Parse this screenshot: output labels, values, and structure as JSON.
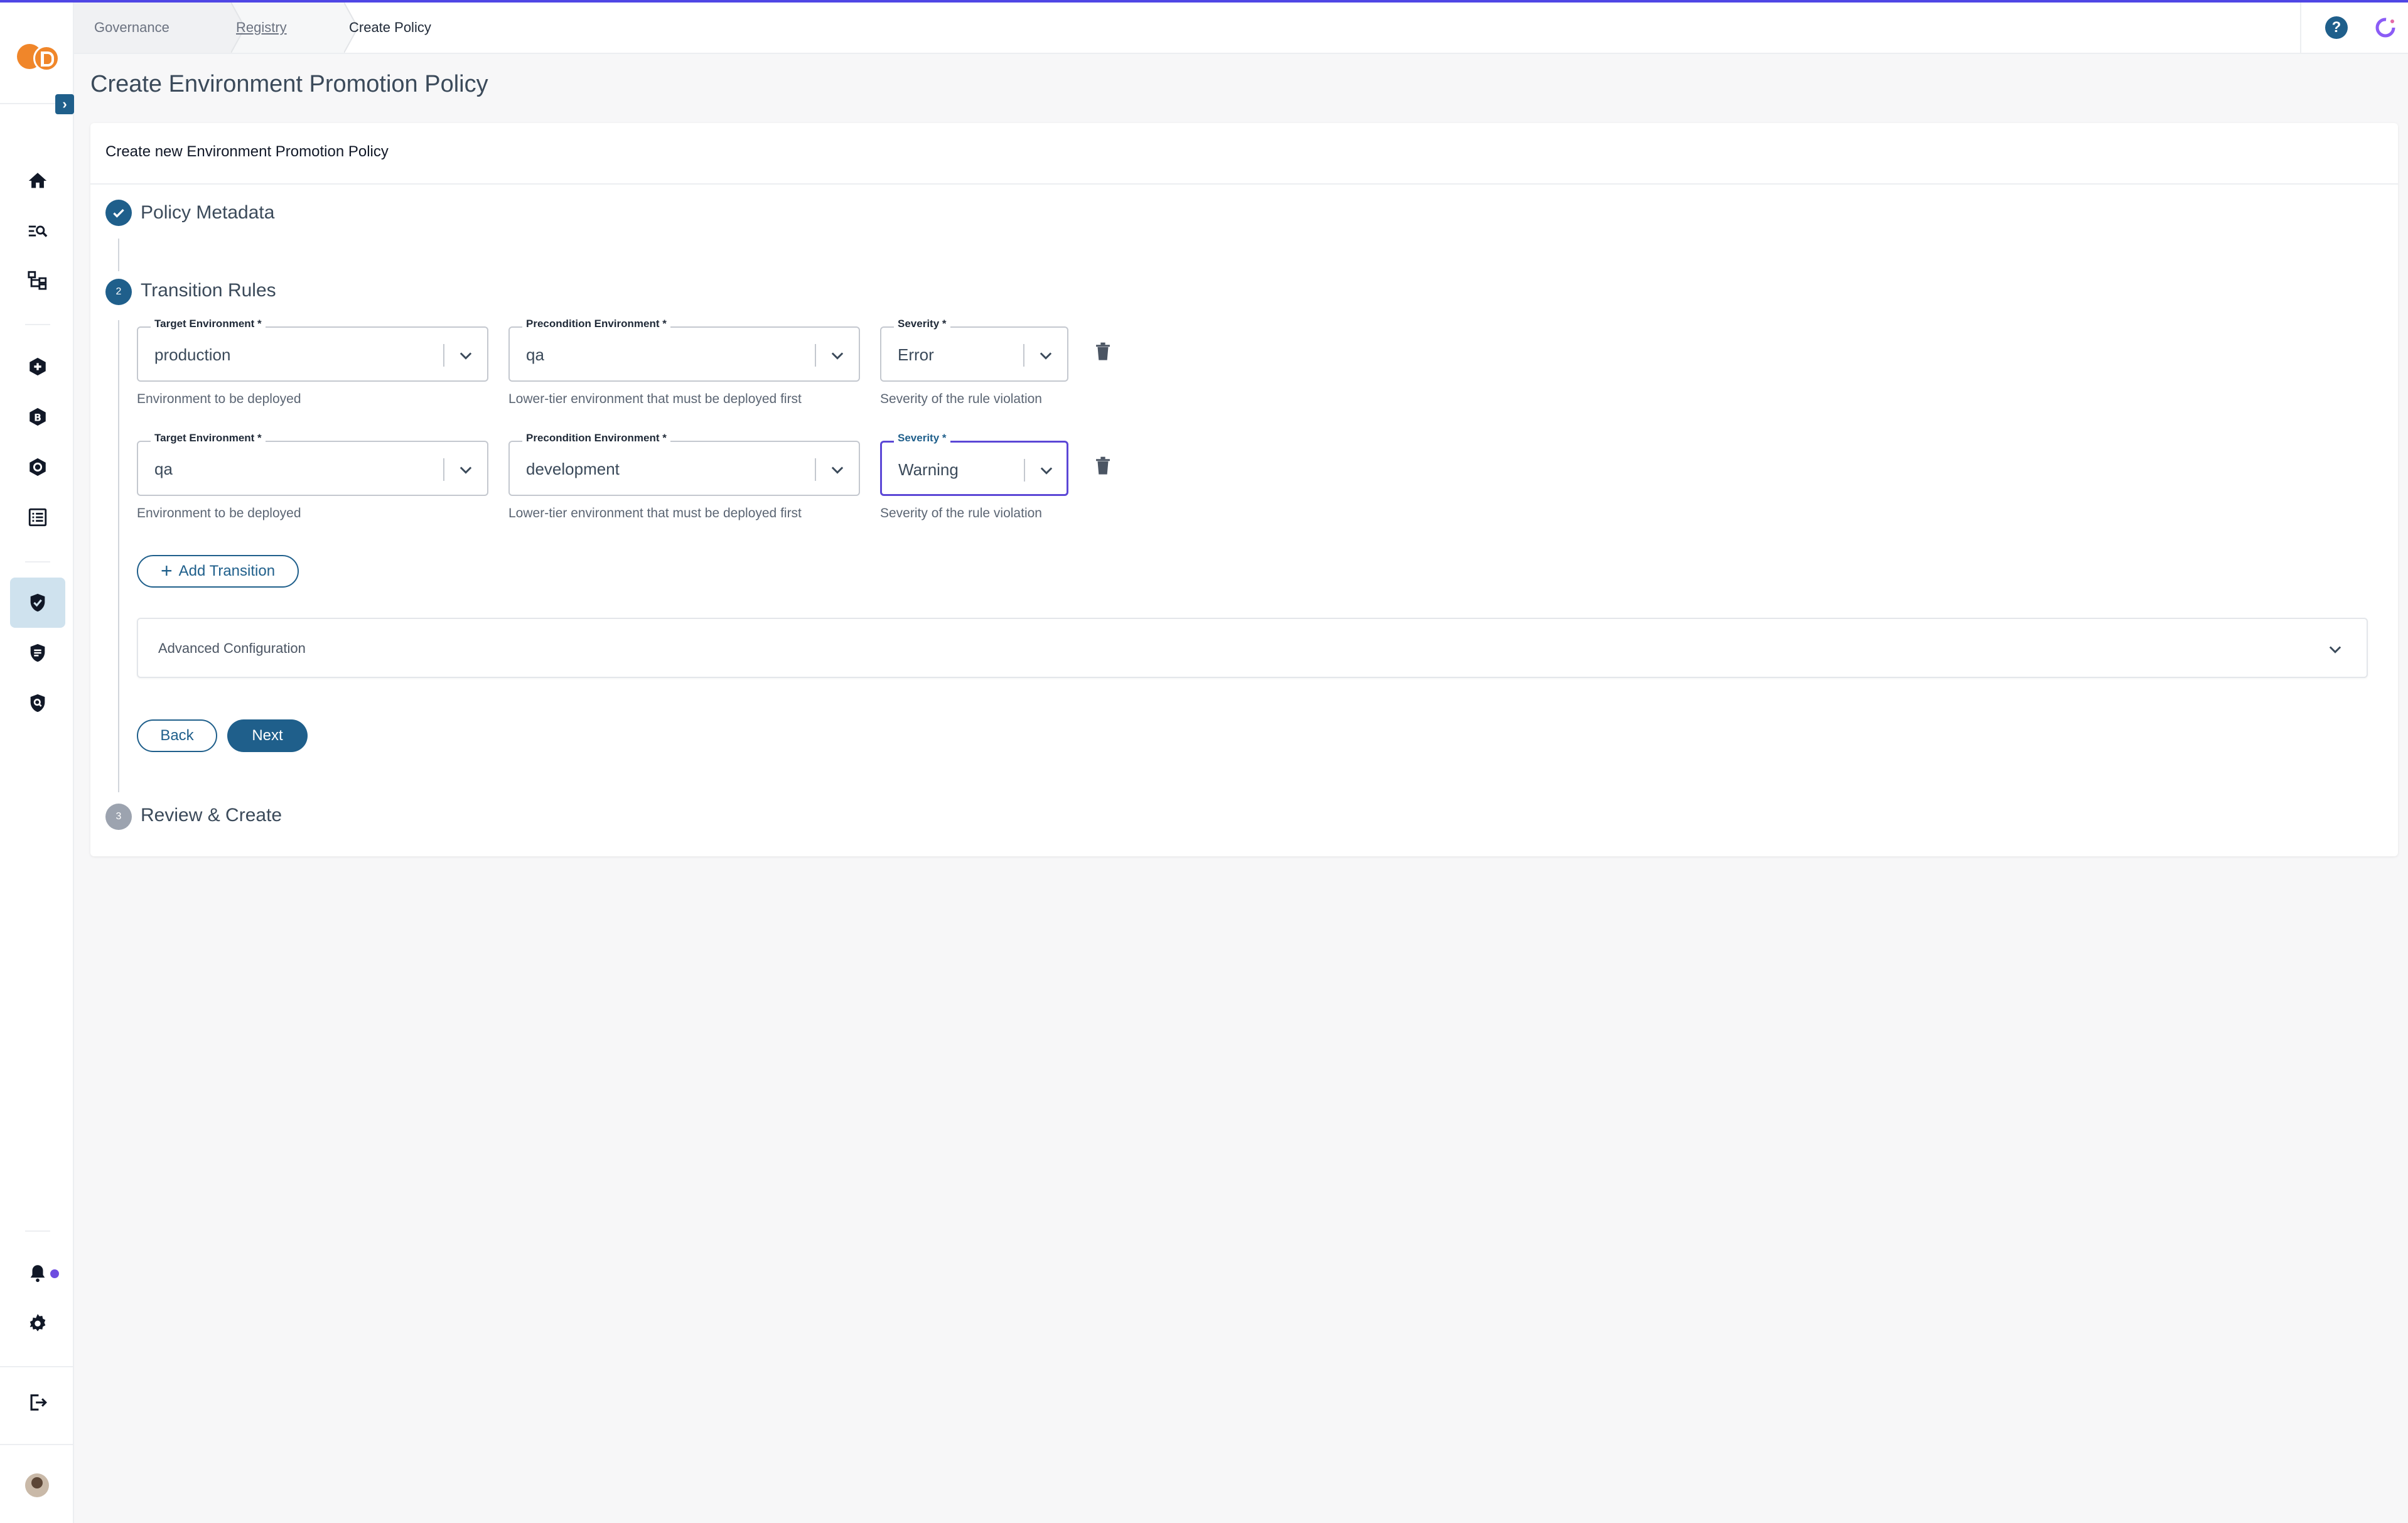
{
  "breadcrumb": {
    "items": [
      "Governance",
      "Registry",
      "Create Policy"
    ]
  },
  "page": {
    "title": "Create Environment Promotion Policy"
  },
  "card": {
    "title": "Create new Environment Promotion Policy"
  },
  "steps": [
    {
      "label": "Policy Metadata",
      "status": "complete",
      "number": "1"
    },
    {
      "label": "Transition Rules",
      "status": "active",
      "number": "2"
    },
    {
      "label": "Review & Create",
      "status": "pending",
      "number": "3"
    }
  ],
  "rules": [
    {
      "target": {
        "label": "Target Environment *",
        "value": "production",
        "helper": "Environment to be deployed"
      },
      "precondition": {
        "label": "Precondition Environment *",
        "value": "qa",
        "helper": "Lower-tier environment that must be deployed first"
      },
      "severity": {
        "label": "Severity *",
        "value": "Error",
        "helper": "Severity of the rule violation"
      }
    },
    {
      "target": {
        "label": "Target Environment *",
        "value": "qa",
        "helper": "Environment to be deployed"
      },
      "precondition": {
        "label": "Precondition Environment *",
        "value": "development",
        "helper": "Lower-tier environment that must be deployed first"
      },
      "severity": {
        "label": "Severity *",
        "value": "Warning",
        "helper": "Severity of the rule violation"
      }
    }
  ],
  "actions": {
    "add_transition": "Add Transition",
    "advanced_configuration": "Advanced Configuration",
    "back": "Back",
    "next": "Next"
  },
  "topbar": {
    "help_glyph": "?"
  },
  "colors": {
    "primary": "#1f5f8b",
    "focus": "#5b47d6",
    "accent_line": "#4f46e5",
    "logo": "#f0862a"
  }
}
